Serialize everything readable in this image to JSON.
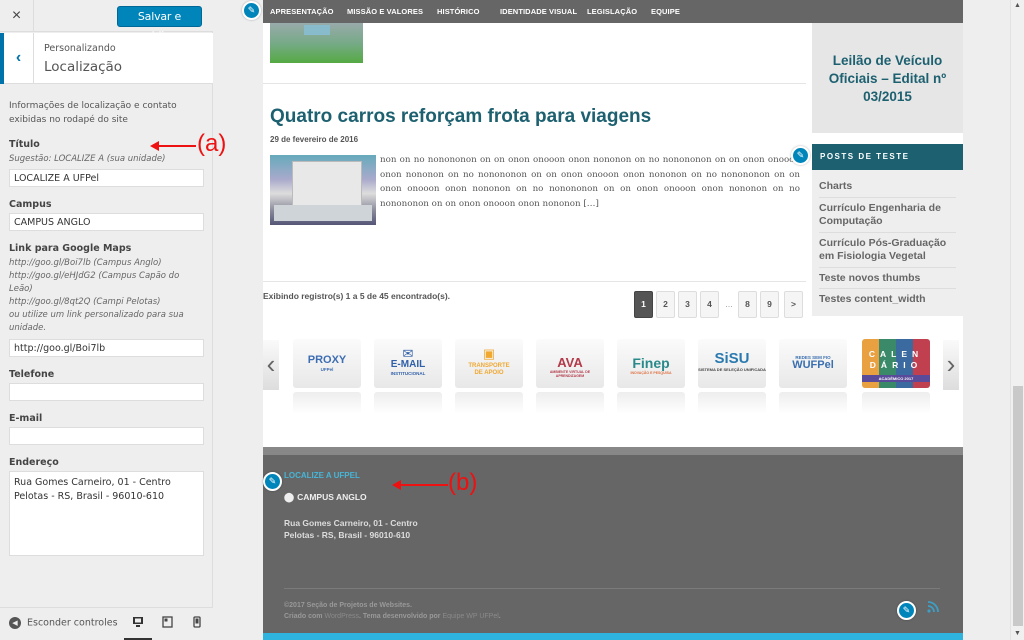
{
  "customizer": {
    "close_icon": "×",
    "publish_label": "Salvar e publicar",
    "back_icon": "‹",
    "breadcrumb": "Personalizando",
    "section_title": "Localização",
    "description": "Informações de localização e contato exibidas no rodapé do site",
    "fields": {
      "titulo": {
        "label": "Título",
        "hint": "Sugestão: LOCALIZE A (sua unidade)",
        "value": "LOCALIZE A UFPel"
      },
      "campus": {
        "label": "Campus",
        "value": "CAMPUS ANGLO"
      },
      "maps": {
        "label": "Link para Google Maps",
        "hints": [
          "http://goo.gl/Boi7lb (Campus Anglo)",
          "http://goo.gl/eHJdG2 (Campus Capão do Leão)",
          "http://goo.gl/8qt2Q (Campi Pelotas)",
          "ou utilize um link personalizado para sua unidade."
        ],
        "value": "http://goo.gl/Boi7lb"
      },
      "telefone": {
        "label": "Telefone",
        "value": ""
      },
      "email": {
        "label": "E-mail",
        "value": ""
      },
      "endereco": {
        "label": "Endereço",
        "value": "Rua Gomes Carneiro, 01 - Centro\nPelotas - RS, Brasil - 96010-610"
      }
    },
    "footer": {
      "hide_controls_label": "Esconder controles",
      "devices": [
        "desktop",
        "tablet",
        "mobile"
      ],
      "active_device": "desktop"
    }
  },
  "preview": {
    "nav": [
      "APRESENTAÇÃO",
      "MISSÃO E VALORES",
      "HISTÓRICO",
      "IDENTIDADE VISUAL",
      "LEGISLAÇÃO",
      "EQUIPE"
    ],
    "post": {
      "title": "Quatro carros reforçam frota para viagens",
      "date": "29 de fevereiro de 2016",
      "excerpt": "non on no nonononon on on onon onooon onon nononon on no nonononon on on onon onooon onon nononon on no nonononon on on onon onooon onon nononon on no nonononon on on onon onooon onon nononon on no nonononon on on onon onooon onon nononon on no nonononon on on onon onooon onon nononon […]"
    },
    "records_info": "Exibindo registro(s) 1 a 5 de 45 encontrado(s).",
    "pagination": {
      "pages": [
        "1",
        "2",
        "3",
        "4",
        "8",
        "9"
      ],
      "ellipsis": "…",
      "next": ">",
      "current": "1"
    },
    "sidebar_widget": {
      "featured_title": "Leilão de Veículo Oficiais – Edital nº 03/2015",
      "posts_header": "POSTS DE TESTE",
      "posts": [
        "Charts",
        "Currículo Engenharia de Computação",
        "Currículo Pós-Graduação em Fisiologia Vegetal",
        "Teste novos thumbs",
        "Testes content_width"
      ]
    },
    "carousel": {
      "prev_icon": "‹",
      "next_icon": "›",
      "items": [
        {
          "name": "PROXY",
          "sub": "UFPel",
          "color": "#3d6db3"
        },
        {
          "name": "E-MAIL",
          "sub": "INSTITUCIONAL",
          "color": "#2f5fa8"
        },
        {
          "name": "TRANSPORTE",
          "sub": "DE APOIO",
          "color": "#f0a830"
        },
        {
          "name": "AVA",
          "sub": "AMBIENTE VIRTUAL DE APRENDIZAGEM",
          "color": "#b23a4a"
        },
        {
          "name": "Finep",
          "sub": "INOVAÇÃO E PESQUISA",
          "color": "#2a8a8a"
        },
        {
          "name": "SiSU",
          "sub": "SISTEMA DE SELEÇÃO UNIFICADA",
          "color": "#2a7ab0"
        },
        {
          "name": "WUFPel",
          "sub": "REDES SEM FIO",
          "color": "#3a6fb0"
        },
        {
          "name": "CALENDÁRIO",
          "sub": "ACADÊMICO 2017",
          "color": "#5a4a9a"
        }
      ]
    },
    "site_footer": {
      "title": "LOCALIZE A UFPEL",
      "campus": "CAMPUS ANGLO",
      "address": "Rua Gomes Carneiro, 01 - Centro\nPelotas - RS, Brasil - 96010-610",
      "copyright": "©2017 Seção de Projetos de Websites.",
      "created_with": "Criado com",
      "wordpress": "WordPress",
      "theme_by": ". Tema desenvolvido por",
      "team": "Equipe WP UFPel",
      "end": "."
    }
  },
  "annotations": {
    "a": "(a)",
    "b": "(b)"
  },
  "colors": {
    "accent": "#0085ba",
    "teal_title": "#1d6070",
    "footer_bg": "#666666",
    "footer_title": "#47b5d6",
    "bottom_bar": "#2fb4e0",
    "annotation": "#ee1111"
  }
}
